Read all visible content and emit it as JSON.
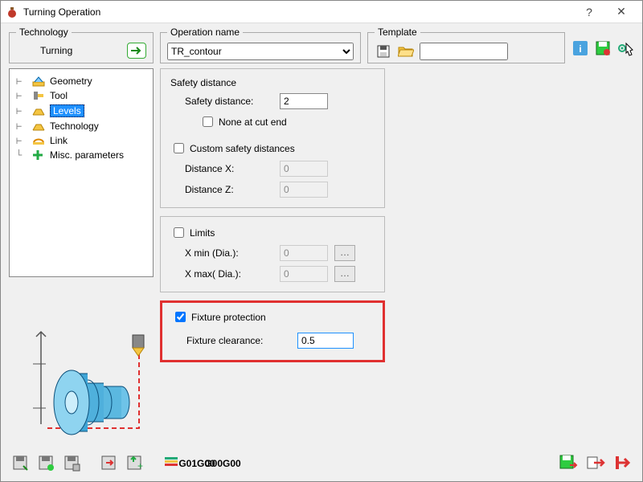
{
  "window": {
    "title": "Turning Operation"
  },
  "top": {
    "technology_legend": "Technology",
    "technology_value": "Turning",
    "operation_legend": "Operation name",
    "operation_value": "TR_contour",
    "template_legend": "Template"
  },
  "tree": {
    "items": [
      {
        "label": "Geometry"
      },
      {
        "label": "Tool"
      },
      {
        "label": "Levels"
      },
      {
        "label": "Technology"
      },
      {
        "label": "Link"
      },
      {
        "label": "Misc. parameters"
      }
    ],
    "selected_index": 2
  },
  "safety": {
    "header": "Safety distance",
    "distance_label": "Safety distance:",
    "distance_value": "2",
    "none_label": "None at cut end",
    "none_checked": false,
    "custom_label": "Custom safety distances",
    "custom_checked": false,
    "dx_label": "Distance X:",
    "dx_value": "0",
    "dz_label": "Distance Z:",
    "dz_value": "0"
  },
  "limits": {
    "header": "Limits",
    "checked": false,
    "xmin_label": "X min (Dia.):",
    "xmin_value": "0",
    "xmax_label": "X max( Dia.):",
    "xmax_value": "0"
  },
  "fixture": {
    "header": "Fixture protection",
    "checked": true,
    "clearance_label": "Fixture clearance:",
    "clearance_value": "0.5"
  },
  "gcode": {
    "g01a": "G01",
    "g00a": "G00",
    "g00b": "G00",
    "g00c": "G00"
  }
}
